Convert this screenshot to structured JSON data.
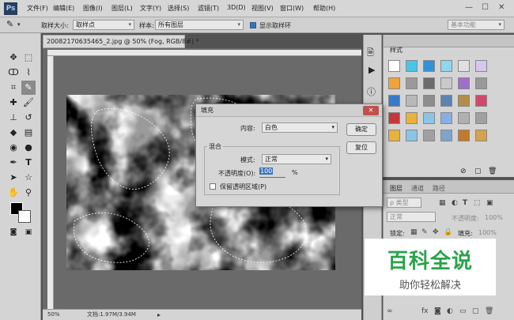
{
  "app": {
    "logo": "Ps"
  },
  "menus": [
    "文件(F)",
    "编辑(E)",
    "图像(I)",
    "图层(L)",
    "文字(Y)",
    "选择(S)",
    "滤镜(T)",
    "3D(D)",
    "视图(V)",
    "窗口(W)",
    "帮助(H)"
  ],
  "window_controls": {
    "minimize": "—",
    "maximize": "☐",
    "close": "✕"
  },
  "options": {
    "sample_size_label": "取样大小:",
    "sample_size_value": "取样点",
    "sample_label": "样本:",
    "sample_value": "所有图层",
    "show_ring_label": "显示取样环",
    "workspace": "基本功能"
  },
  "document": {
    "tab_title": "20082170635465_2.jpg @ 50% (Fog, RGB/8#) *",
    "tab_close": "×",
    "zoom": "50%",
    "doc_info": "文档:1.97M/3.94M"
  },
  "styles_panel": {
    "tab": "样式"
  },
  "layers_panel": {
    "tabs": [
      "图层",
      "通道",
      "路径"
    ],
    "kind_label": "ρ 类型",
    "blend_mode": "正常",
    "opacity_label": "不透明度:",
    "opacity_value": "100%",
    "lock_label": "锁定:",
    "fill_label": "填充:",
    "fill_value": "100%"
  },
  "fill_dialog": {
    "title": "填充",
    "close": "✕",
    "contents_label": "内容:",
    "contents_value": "白色",
    "ok": "确定",
    "reset": "复位",
    "blend_group": "混合",
    "mode_label": "模式:",
    "mode_value": "正常",
    "opacity_label": "不透明度(O):",
    "opacity_value": "100",
    "opacity_unit": "%",
    "preserve_label": "保留透明区域(P)"
  },
  "watermark": {
    "title": "百科全说",
    "subtitle": "助你轻松解决"
  },
  "colors": {
    "accent": "#3b73b9",
    "dialog_close": "#c0504d",
    "watermark_title": "#2aa34a"
  }
}
